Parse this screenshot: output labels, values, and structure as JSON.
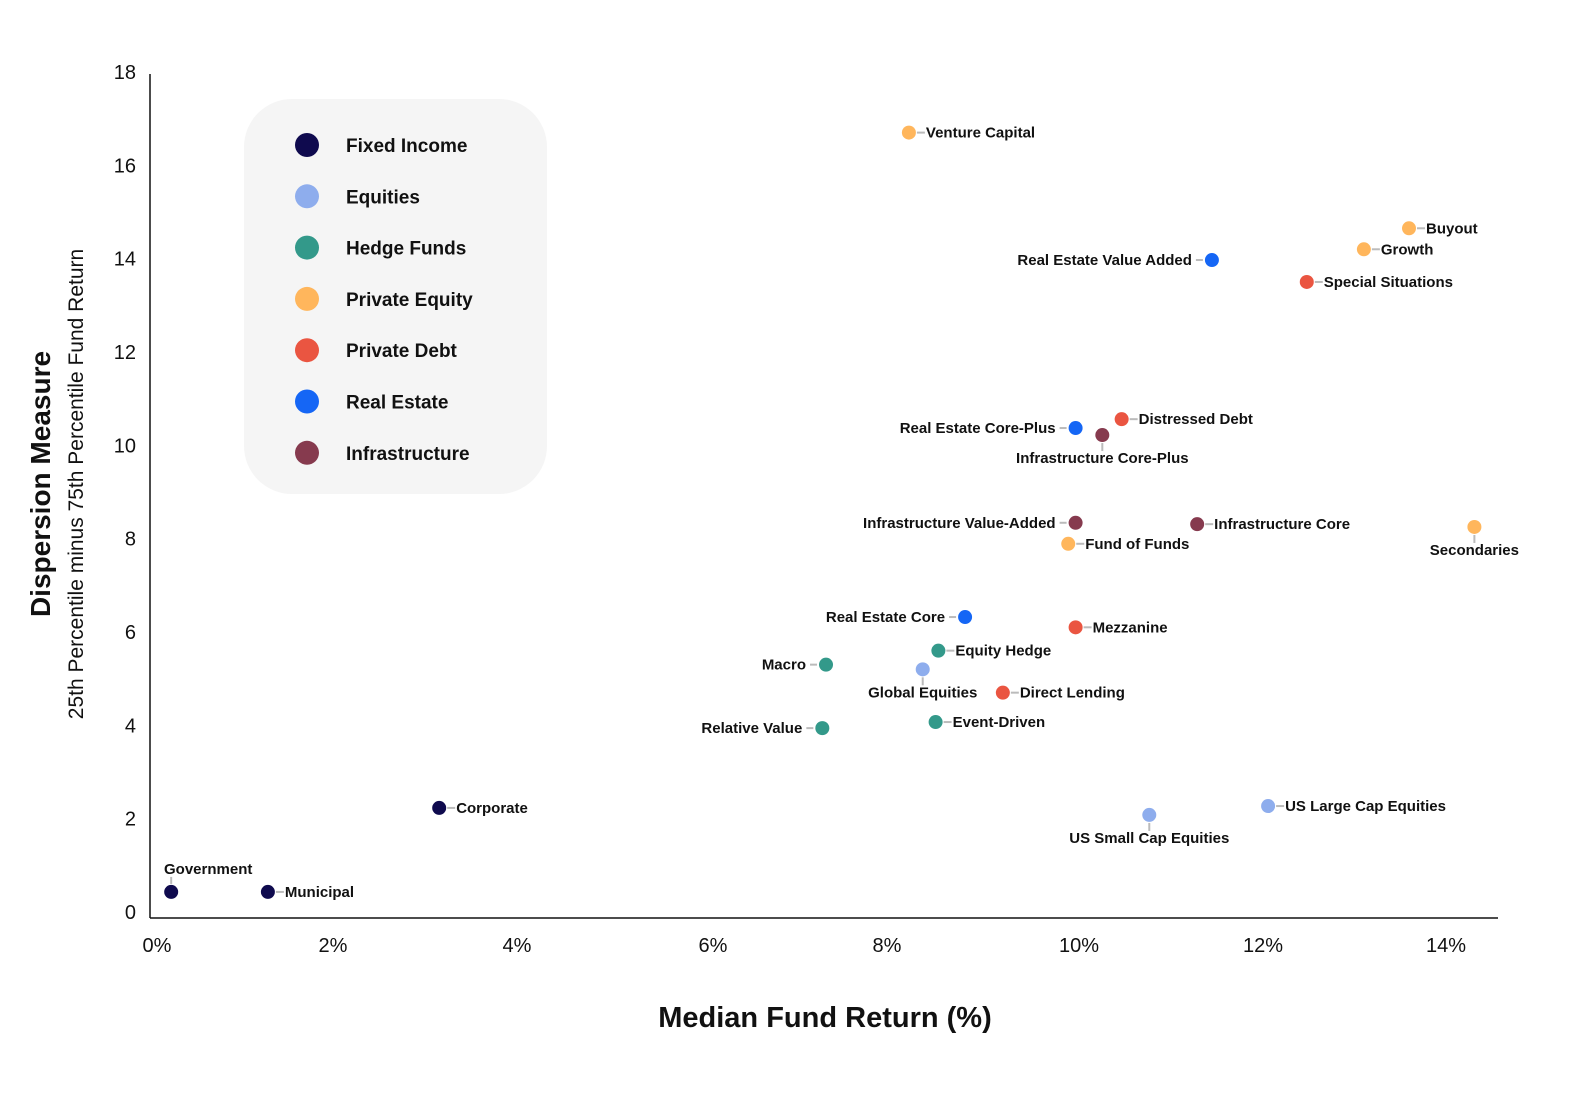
{
  "chart_data": {
    "type": "scatter",
    "title": "",
    "xlabel": "Median Fund Return (%)",
    "ylabel": "Dispersion Measure",
    "ylabel_sub": "25th Percentile minus 75th Percentile Fund Return",
    "xlim": [
      0,
      14.6
    ],
    "ylim": [
      0,
      18
    ],
    "x_ticks": [
      0,
      2,
      4,
      6,
      8,
      10,
      12,
      14
    ],
    "x_tick_labels": [
      "0%",
      "2%",
      "4%",
      "6%",
      "8%",
      "10%",
      "12%",
      "14%"
    ],
    "y_ticks": [
      0,
      2,
      4,
      6,
      8,
      10,
      12,
      14,
      16,
      18
    ],
    "y_tick_labels": [
      "0",
      "2",
      "4",
      "6",
      "8",
      "10",
      "12",
      "14",
      "16",
      "18"
    ],
    "grid": false,
    "legend_placement": "top-left",
    "series": [
      {
        "name": "Fixed Income",
        "color": "#0f0a4e",
        "points": [
          {
            "label": "Government",
            "x": 0.23,
            "y": 0.43,
            "label_pos": "top"
          },
          {
            "label": "Municipal",
            "x": 1.28,
            "y": 0.43,
            "label_pos": "right"
          },
          {
            "label": "Corporate",
            "x": 3.14,
            "y": 2.23,
            "label_pos": "right"
          }
        ]
      },
      {
        "name": "Equities",
        "color": "#8eaded",
        "points": [
          {
            "label": "Global Equities",
            "x": 8.39,
            "y": 5.2,
            "label_pos": "bottom"
          },
          {
            "label": "US Small Cap Equities",
            "x": 10.85,
            "y": 2.08,
            "label_pos": "bottom"
          },
          {
            "label": "US Large Cap Equities",
            "x": 12.14,
            "y": 2.27,
            "label_pos": "right"
          }
        ]
      },
      {
        "name": "Hedge Funds",
        "color": "#33998a",
        "points": [
          {
            "label": "Macro",
            "x": 7.34,
            "y": 5.3,
            "label_pos": "left"
          },
          {
            "label": "Relative Value",
            "x": 7.3,
            "y": 3.94,
            "label_pos": "left"
          },
          {
            "label": "Equity Hedge",
            "x": 8.56,
            "y": 5.6,
            "label_pos": "right"
          },
          {
            "label": "Event-Driven",
            "x": 8.53,
            "y": 4.07,
            "label_pos": "right"
          }
        ]
      },
      {
        "name": "Private Equity",
        "color": "#ffb65c",
        "points": [
          {
            "label": "Venture Capital",
            "x": 8.24,
            "y": 16.7,
            "label_pos": "right"
          },
          {
            "label": "Buyout",
            "x": 13.67,
            "y": 14.65,
            "label_pos": "right"
          },
          {
            "label": "Growth",
            "x": 13.18,
            "y": 14.2,
            "label_pos": "right"
          },
          {
            "label": "Fund of Funds",
            "x": 9.97,
            "y": 7.89,
            "label_pos": "right"
          },
          {
            "label": "Secondaries",
            "x": 14.38,
            "y": 8.25,
            "label_pos": "bottom"
          }
        ]
      },
      {
        "name": "Private Debt",
        "color": "#ea5541",
        "points": [
          {
            "label": "Special Situations",
            "x": 12.56,
            "y": 13.5,
            "label_pos": "right"
          },
          {
            "label": "Distressed Debt",
            "x": 10.55,
            "y": 10.56,
            "label_pos": "right"
          },
          {
            "label": "Mezzanine",
            "x": 10.05,
            "y": 6.1,
            "label_pos": "right"
          },
          {
            "label": "Direct Lending",
            "x": 9.26,
            "y": 4.7,
            "label_pos": "right"
          }
        ]
      },
      {
        "name": "Real Estate",
        "color": "#1566f5",
        "points": [
          {
            "label": "Real Estate Value Added",
            "x": 11.53,
            "y": 13.97,
            "label_pos": "left"
          },
          {
            "label": "Real Estate Core-Plus",
            "x": 10.05,
            "y": 10.37,
            "label_pos": "left"
          },
          {
            "label": "Real Estate Core",
            "x": 8.85,
            "y": 6.32,
            "label_pos": "left"
          }
        ]
      },
      {
        "name": "Infrastructure",
        "color": "#863a4e",
        "points": [
          {
            "label": "Infrastructure Core-Plus",
            "x": 10.34,
            "y": 10.22,
            "label_pos": "bottom"
          },
          {
            "label": "Infrastructure Value-Added",
            "x": 10.05,
            "y": 8.34,
            "label_pos": "left"
          },
          {
            "label": "Infrastructure Core",
            "x": 11.37,
            "y": 8.31,
            "label_pos": "right"
          }
        ]
      }
    ]
  },
  "legend": {
    "background": "#f5f5f5",
    "items": [
      {
        "label": "Fixed Income",
        "color": "#0f0a4e"
      },
      {
        "label": "Equities",
        "color": "#8eaded"
      },
      {
        "label": "Hedge Funds",
        "color": "#33998a"
      },
      {
        "label": "Private Equity",
        "color": "#ffb65c"
      },
      {
        "label": "Private Debt",
        "color": "#ea5541"
      },
      {
        "label": "Real Estate",
        "color": "#1566f5"
      },
      {
        "label": "Infrastructure",
        "color": "#863a4e"
      }
    ]
  },
  "colors": {
    "axis": "#111111",
    "leader_line": "#bbbbbb",
    "text": "#111111"
  }
}
